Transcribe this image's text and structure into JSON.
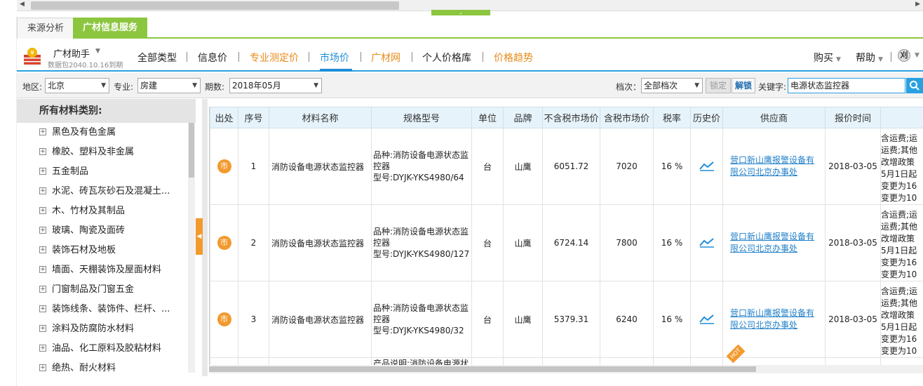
{
  "tabs": {
    "source": "来源分析",
    "service": "广材信息服务"
  },
  "assistant": {
    "name": "广材助手",
    "expire": "数据包2040.10.16到期"
  },
  "nav": [
    {
      "label": "全部类型",
      "style": "normal"
    },
    {
      "label": "信息价",
      "style": "normal"
    },
    {
      "label": "专业测定价",
      "style": "orange"
    },
    {
      "label": "市场价",
      "style": "active"
    },
    {
      "label": "广材网",
      "style": "orange"
    },
    {
      "label": "个人价格库",
      "style": "normal"
    },
    {
      "label": "价格趋势",
      "style": "orange"
    }
  ],
  "nav_right": {
    "buy": "购买",
    "help": "帮助",
    "user_initial": "刈"
  },
  "filters": {
    "region_label": "地区:",
    "region": "北京",
    "major_label": "专业:",
    "major": "房建",
    "period_label": "期数:",
    "period": "2018年05月",
    "grade_label": "档次：",
    "grade": "全部档次",
    "lock": "锁定",
    "unlock": "解锁",
    "keyword_label": "关键字:",
    "keyword": "电源状态监控器"
  },
  "sidebar": {
    "title": "所有材料类别:",
    "categories": [
      "黑色及有色金属",
      "橡胶、塑料及非金属",
      "五金制品",
      "水泥、砖瓦灰砂石及混凝土...",
      "木、竹材及其制品",
      "玻璃、陶瓷及面砖",
      "装饰石材及地板",
      "墙面、天棚装饰及屋面材料",
      "门窗制品及门窗五金",
      "装饰线条、装饰件、栏杆、...",
      "涂料及防腐防水材料",
      "油品、化工原料及胶粘材料",
      "绝热、耐火材料"
    ]
  },
  "table": {
    "headers": [
      "出处",
      "序号",
      "材料名称",
      "规格型号",
      "单位",
      "品牌",
      "不含税市场价",
      "含税市场价",
      "税率",
      "历史价",
      "供应商",
      "报价时间",
      ""
    ],
    "source_badge": "市",
    "rows": [
      {
        "seq": "1",
        "name": "消防设备电源状态监控器",
        "spec": [
          "品种:消防设备电源状态监",
          "控器",
          "型号:DYJK-YKS4980/64"
        ],
        "unit": "台",
        "brand": "山鹰",
        "price_ex": "6051.72",
        "price_in": "7020",
        "tax": "16 %",
        "supplier": [
          "营口新山鹰报警设备有",
          "限公司北京办事处"
        ],
        "date": "2018-03-05",
        "note": [
          "含运费;运",
          "运费;其他",
          "改增政策",
          "5月1日起",
          "变更为16",
          "变更为10"
        ]
      },
      {
        "seq": "2",
        "name": "消防设备电源状态监控器",
        "spec": [
          "品种:消防设备电源状态监",
          "控器",
          "型号:DYJK-YKS4980/127"
        ],
        "unit": "台",
        "brand": "山鹰",
        "price_ex": "6724.14",
        "price_in": "7800",
        "tax": "16 %",
        "supplier": [
          "营口新山鹰报警设备有",
          "限公司北京办事处"
        ],
        "date": "2018-03-05",
        "note": [
          "含运费;运",
          "运费;其他",
          "改增政策",
          "5月1日起",
          "变更为16",
          "变更为10"
        ]
      },
      {
        "seq": "3",
        "name": "消防设备电源状态监控器",
        "spec": [
          "品种:消防设备电源状态监",
          "控器",
          "型号:DYJK-YKS4980/32"
        ],
        "unit": "台",
        "brand": "山鹰",
        "price_ex": "5379.31",
        "price_in": "6240",
        "tax": "16 %",
        "supplier": [
          "营口新山鹰报警设备有",
          "限公司北京办事处"
        ],
        "date": "2018-03-05",
        "note": [
          "含运费;运",
          "运费;其他",
          "改增政策",
          "5月1日起",
          "变更为16",
          "变更为10"
        ]
      }
    ],
    "partial_spec": "产品说明:消防设备电源状",
    "hot": "HOT"
  }
}
